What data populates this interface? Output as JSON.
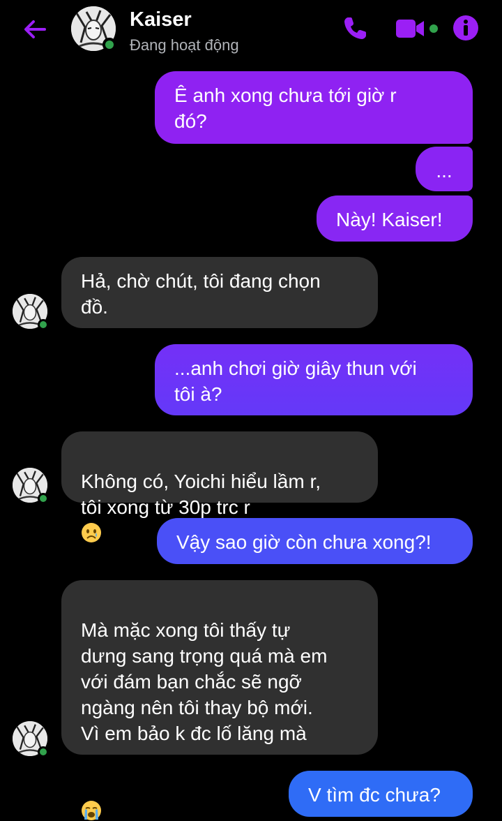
{
  "header": {
    "contact_name": "Kaiser",
    "status": "Đang hoạt động"
  },
  "icons": {
    "back": "arrow-left-icon",
    "phone": "phone-icon",
    "video": "video-camera-icon",
    "info": "info-icon"
  },
  "colors": {
    "accent": "#9b1ff5",
    "outgoing_top": "#8f22f2",
    "outgoing_bottom": "#3f5cf5",
    "incoming": "#303030",
    "online": "#31a24c"
  },
  "messages": [
    {
      "from": "me",
      "text": "Ê anh xong chưa tới giờ r\nđó?"
    },
    {
      "from": "me",
      "text": "..."
    },
    {
      "from": "me",
      "text": "Này! Kaiser!"
    },
    {
      "from": "them",
      "text": "Hả, chờ chút, tôi đang chọn\nđồ."
    },
    {
      "from": "me",
      "text": "...anh chơi giờ giây thun với\ntôi à?"
    },
    {
      "from": "them",
      "text": "Không có, Yoichi hiểu lầm r,\ntôi xong từ 30p trc r",
      "emoji": "sad-face-emoji"
    },
    {
      "from": "me",
      "text": "Vậy sao giờ còn chưa xong?!"
    },
    {
      "from": "them",
      "text": "Mà mặc xong tôi thấy tự\ndưng sang trọng quá mà em\nvới đám bạn chắc sẽ ngỡ\nngàng nên tôi thay bộ mới.\nVì em bảo k đc lố lăng mà",
      "emoji": "crying-face-emoji"
    },
    {
      "from": "me",
      "text": "V tìm đc chưa?"
    }
  ]
}
